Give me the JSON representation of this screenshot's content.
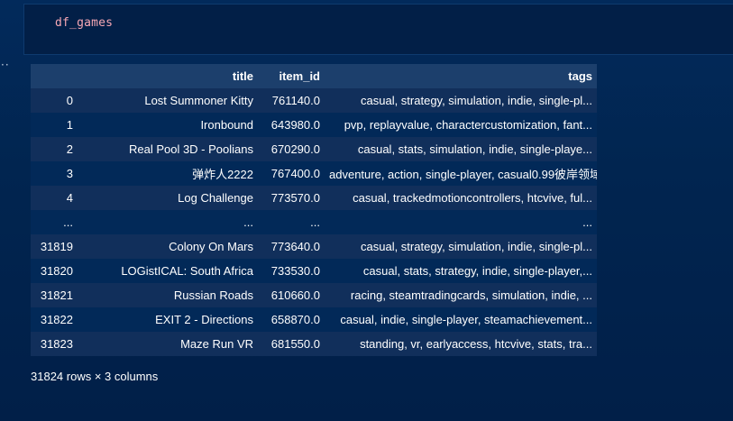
{
  "code_cell": {
    "code": "df_games"
  },
  "output": {
    "indicator": "··"
  },
  "dataframe": {
    "index_header": "",
    "columns": [
      "title",
      "item_id",
      "tags"
    ],
    "rows": [
      {
        "index": "0",
        "title": "Lost Summoner Kitty",
        "item_id": "761140.0",
        "tags": "casual, strategy, simulation, indie, single-pl..."
      },
      {
        "index": "1",
        "title": "Ironbound",
        "item_id": "643980.0",
        "tags": "pvp, replayvalue, charactercustomization, fant..."
      },
      {
        "index": "2",
        "title": "Real Pool 3D - Poolians",
        "item_id": "670290.0",
        "tags": "casual, stats, simulation, indie, single-playe..."
      },
      {
        "index": "3",
        "title": "弹炸人2222",
        "item_id": "767400.0",
        "tags": "adventure, action, single-player, casual0.99彼岸领域"
      },
      {
        "index": "4",
        "title": "Log Challenge",
        "item_id": "773570.0",
        "tags": "casual, trackedmotioncontrollers, htcvive, ful..."
      },
      {
        "index": "...",
        "title": "...",
        "item_id": "...",
        "tags": "..."
      },
      {
        "index": "31819",
        "title": "Colony On Mars",
        "item_id": "773640.0",
        "tags": "casual, strategy, simulation, indie, single-pl..."
      },
      {
        "index": "31820",
        "title": "LOGistICAL: South Africa",
        "item_id": "733530.0",
        "tags": "casual, stats, strategy, indie, single-player,..."
      },
      {
        "index": "31821",
        "title": "Russian Roads",
        "item_id": "610660.0",
        "tags": "racing, steamtradingcards, simulation, indie, ..."
      },
      {
        "index": "31822",
        "title": "EXIT 2 - Directions",
        "item_id": "658870.0",
        "tags": "casual, indie, single-player, steamachievement..."
      },
      {
        "index": "31823",
        "title": "Maze Run VR",
        "item_id": "681550.0",
        "tags": "standing, vr, earlyaccess, htcvive, stats, tra..."
      }
    ],
    "shape_text": "31824 rows × 3 columns"
  }
}
